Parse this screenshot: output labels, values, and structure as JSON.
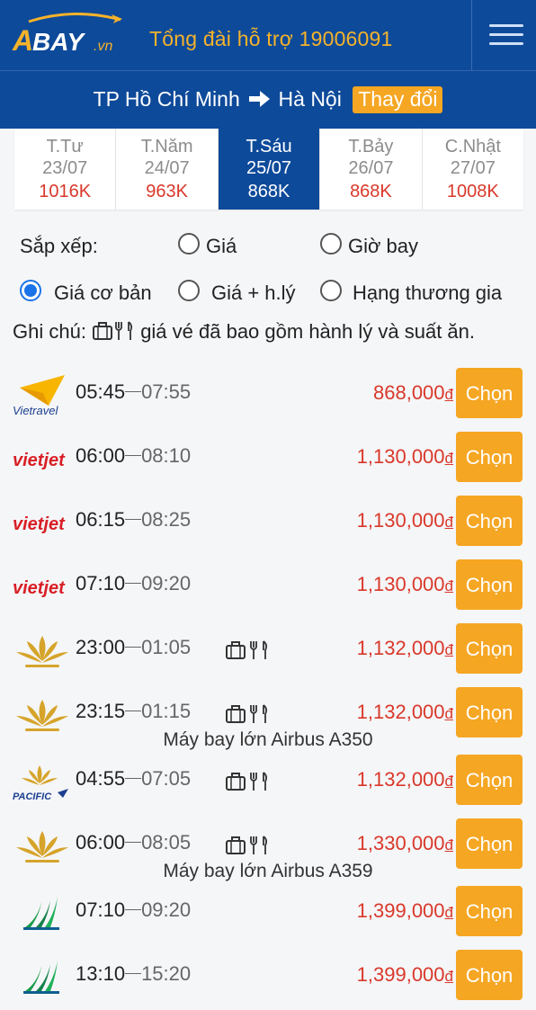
{
  "header": {
    "logo_text": "ABAY.vn",
    "hotline": "Tổng đài hỗ trợ 19006091",
    "menu_icon": "hamburger-menu-icon"
  },
  "route": {
    "from": "TP Hồ Chí Minh",
    "to": "Hà Nội",
    "change_label": "Thay đổi"
  },
  "dates": [
    {
      "dow": "T.Tư",
      "date": "23/07",
      "price": "1016K",
      "active": false
    },
    {
      "dow": "T.Năm",
      "date": "24/07",
      "price": "963K",
      "active": false
    },
    {
      "dow": "T.Sáu",
      "date": "25/07",
      "price": "868K",
      "active": true
    },
    {
      "dow": "T.Bảy",
      "date": "26/07",
      "price": "868K",
      "active": false
    },
    {
      "dow": "C.Nhật",
      "date": "27/07",
      "price": "1008K",
      "active": false
    }
  ],
  "sort": {
    "label": "Sắp xếp:",
    "options": [
      {
        "label": "Giá",
        "selected": false
      },
      {
        "label": "Giờ bay",
        "selected": false
      },
      {
        "label": "Giá cơ bản",
        "selected": true
      },
      {
        "label": "Giá + h.lý",
        "selected": false
      },
      {
        "label": "Hạng thương gia",
        "selected": false
      }
    ]
  },
  "note": {
    "prefix": "Ghi chú:",
    "text": "giá vé đã bao gồm hành lý và suất ăn."
  },
  "flights": [
    {
      "airline": "Vietravel",
      "logo": "vietravel-logo",
      "depart": "05:45",
      "arrive": "07:55",
      "includes": false,
      "price": "868,000",
      "currency": "đ",
      "button": "Chọn"
    },
    {
      "airline": "Vietjet",
      "logo": "vietjet-logo",
      "depart": "06:00",
      "arrive": "08:10",
      "includes": false,
      "price": "1,130,000",
      "currency": "đ",
      "button": "Chọn"
    },
    {
      "airline": "Vietjet",
      "logo": "vietjet-logo",
      "depart": "06:15",
      "arrive": "08:25",
      "includes": false,
      "price": "1,130,000",
      "currency": "đ",
      "button": "Chọn"
    },
    {
      "airline": "Vietjet",
      "logo": "vietjet-logo",
      "depart": "07:10",
      "arrive": "09:20",
      "includes": false,
      "price": "1,130,000",
      "currency": "đ",
      "button": "Chọn"
    },
    {
      "airline": "Vietnam Airlines",
      "logo": "vietnam-airlines-logo",
      "depart": "23:00",
      "arrive": "01:05",
      "includes": true,
      "price": "1,132,000",
      "currency": "đ",
      "button": "Chọn"
    },
    {
      "airline": "Vietnam Airlines",
      "logo": "vietnam-airlines-logo",
      "depart": "23:15",
      "arrive": "01:15",
      "includes": true,
      "price": "1,132,000",
      "currency": "đ",
      "button": "Chọn",
      "aircraft": "Máy bay lớn Airbus A350"
    },
    {
      "airline": "Pacific",
      "logo": "pacific-airlines-logo",
      "depart": "04:55",
      "arrive": "07:05",
      "includes": true,
      "price": "1,132,000",
      "currency": "đ",
      "button": "Chọn"
    },
    {
      "airline": "Vietnam Airlines",
      "logo": "vietnam-airlines-logo",
      "depart": "06:00",
      "arrive": "08:05",
      "includes": true,
      "price": "1,330,000",
      "currency": "đ",
      "button": "Chọn",
      "aircraft": "Máy bay lớn Airbus A359"
    },
    {
      "airline": "Bamboo Airways",
      "logo": "bamboo-airways-logo",
      "depart": "07:10",
      "arrive": "09:20",
      "includes": false,
      "price": "1,399,000",
      "currency": "đ",
      "button": "Chọn"
    },
    {
      "airline": "Bamboo Airways",
      "logo": "bamboo-airways-logo",
      "depart": "13:10",
      "arrive": "15:20",
      "includes": false,
      "price": "1,399,000",
      "currency": "đ",
      "button": "Chọn"
    }
  ],
  "colors": {
    "brand_blue": "#0e4a9a",
    "accent_orange": "#f5a623",
    "price_red": "#d9382a",
    "radio_blue": "#1a73e8"
  }
}
